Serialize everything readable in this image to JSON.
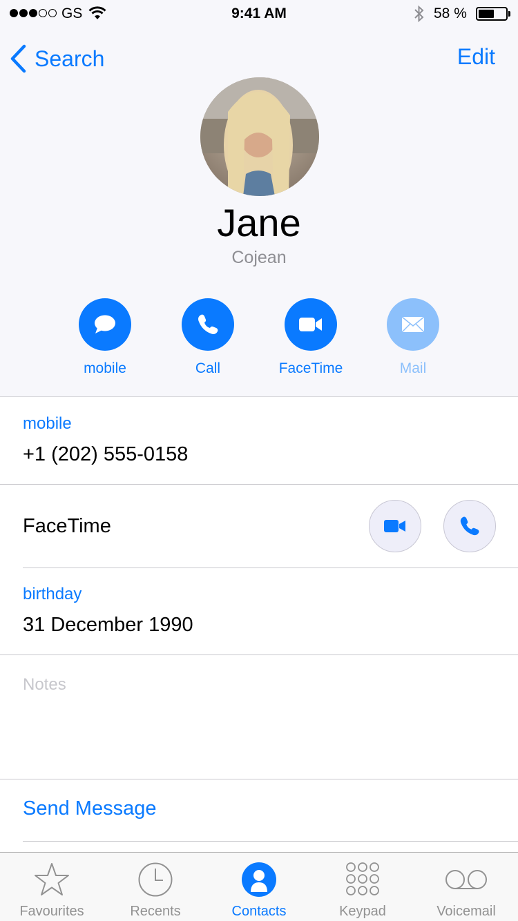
{
  "status_bar": {
    "carrier": "GS",
    "time": "9:41 AM",
    "battery_percent": "58 %",
    "battery_level": 0.58,
    "signal_bars_filled": 3,
    "signal_bars_total": 5
  },
  "nav": {
    "back_label": "Search",
    "edit_label": "Edit"
  },
  "contact": {
    "first_name": "Jane",
    "last_name": "Cojean"
  },
  "actions": [
    {
      "label": "mobile",
      "icon": "message-bubble-icon",
      "enabled": true
    },
    {
      "label": "Call",
      "icon": "phone-icon",
      "enabled": true
    },
    {
      "label": "FaceTime",
      "icon": "video-camera-icon",
      "enabled": true
    },
    {
      "label": "Mail",
      "icon": "envelope-icon",
      "enabled": false
    }
  ],
  "fields": {
    "phone": {
      "label": "mobile",
      "value": "+1 (202) 555-0158"
    },
    "facetime": {
      "label": "FaceTime"
    },
    "birthday": {
      "label": "birthday",
      "value": "31 December 1990"
    },
    "notes": {
      "placeholder": "Notes"
    }
  },
  "send_message_label": "Send Message",
  "tabs": [
    {
      "label": "Favourites",
      "icon": "star-icon",
      "active": false
    },
    {
      "label": "Recents",
      "icon": "clock-icon",
      "active": false
    },
    {
      "label": "Contacts",
      "icon": "person-icon",
      "active": true
    },
    {
      "label": "Keypad",
      "icon": "keypad-icon",
      "active": false
    },
    {
      "label": "Voicemail",
      "icon": "voicemail-icon",
      "active": false
    }
  ],
  "colors": {
    "accent": "#0a7aff",
    "disabled_accent": "#8cc0fb",
    "header_background": "#f7f7fb",
    "inactive_tab": "#929292"
  }
}
